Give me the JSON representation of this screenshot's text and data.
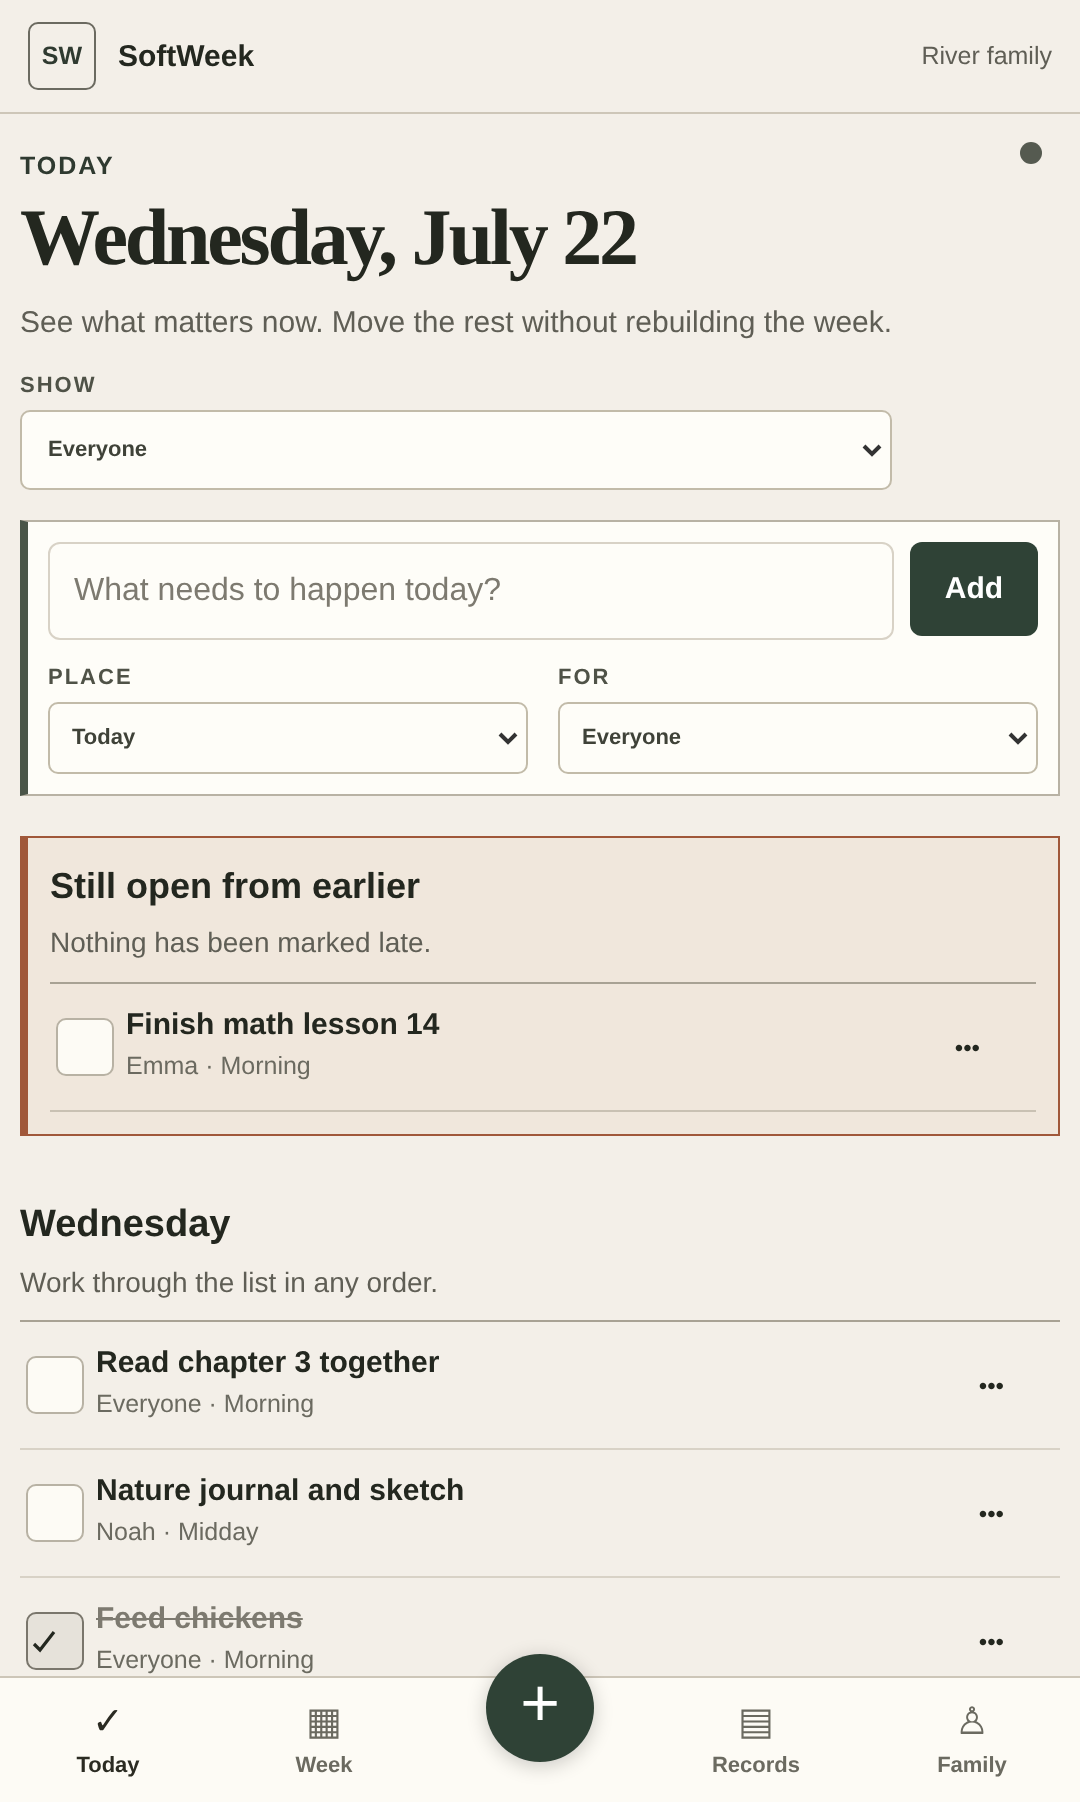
{
  "header": {
    "logo": "SW",
    "app_name": "SoftWeek",
    "family": "River family"
  },
  "today": {
    "eyebrow": "TODAY",
    "date": "Wednesday, July 22",
    "subtitle": "See what matters now. Move the rest without rebuilding the week.",
    "show_label": "SHOW",
    "show_value": "Everyone"
  },
  "composer": {
    "placeholder": "What needs to happen today?",
    "add_label": "Add",
    "place_label": "PLACE",
    "place_value": "Today",
    "for_label": "FOR",
    "for_value": "Everyone"
  },
  "late": {
    "title": "Still open from earlier",
    "subtitle": "Nothing has been marked late.",
    "tasks": [
      {
        "title": "Finish math lesson 14",
        "meta": "Emma · Morning",
        "checked": false,
        "more": "•••"
      }
    ]
  },
  "day": {
    "title": "Wednesday",
    "subtitle": "Work through the list in any order.",
    "tasks": [
      {
        "title": "Read chapter 3 together",
        "meta": "Everyone · Morning",
        "checked": false,
        "more": "•••"
      },
      {
        "title": "Nature journal and sketch",
        "meta": "Noah · Midday",
        "checked": false,
        "more": "•••"
      },
      {
        "title": "Feed chickens",
        "meta": "Everyone · Morning",
        "checked": true,
        "more": "•••"
      }
    ]
  },
  "nav": {
    "fab": "+",
    "items": [
      {
        "icon": "✓",
        "label": "Today",
        "selected": true
      },
      {
        "icon": "▦",
        "label": "Week",
        "selected": false
      },
      {
        "icon": "▤",
        "label": "Records",
        "selected": false
      },
      {
        "icon": "♙",
        "label": "Family",
        "selected": false
      }
    ]
  }
}
